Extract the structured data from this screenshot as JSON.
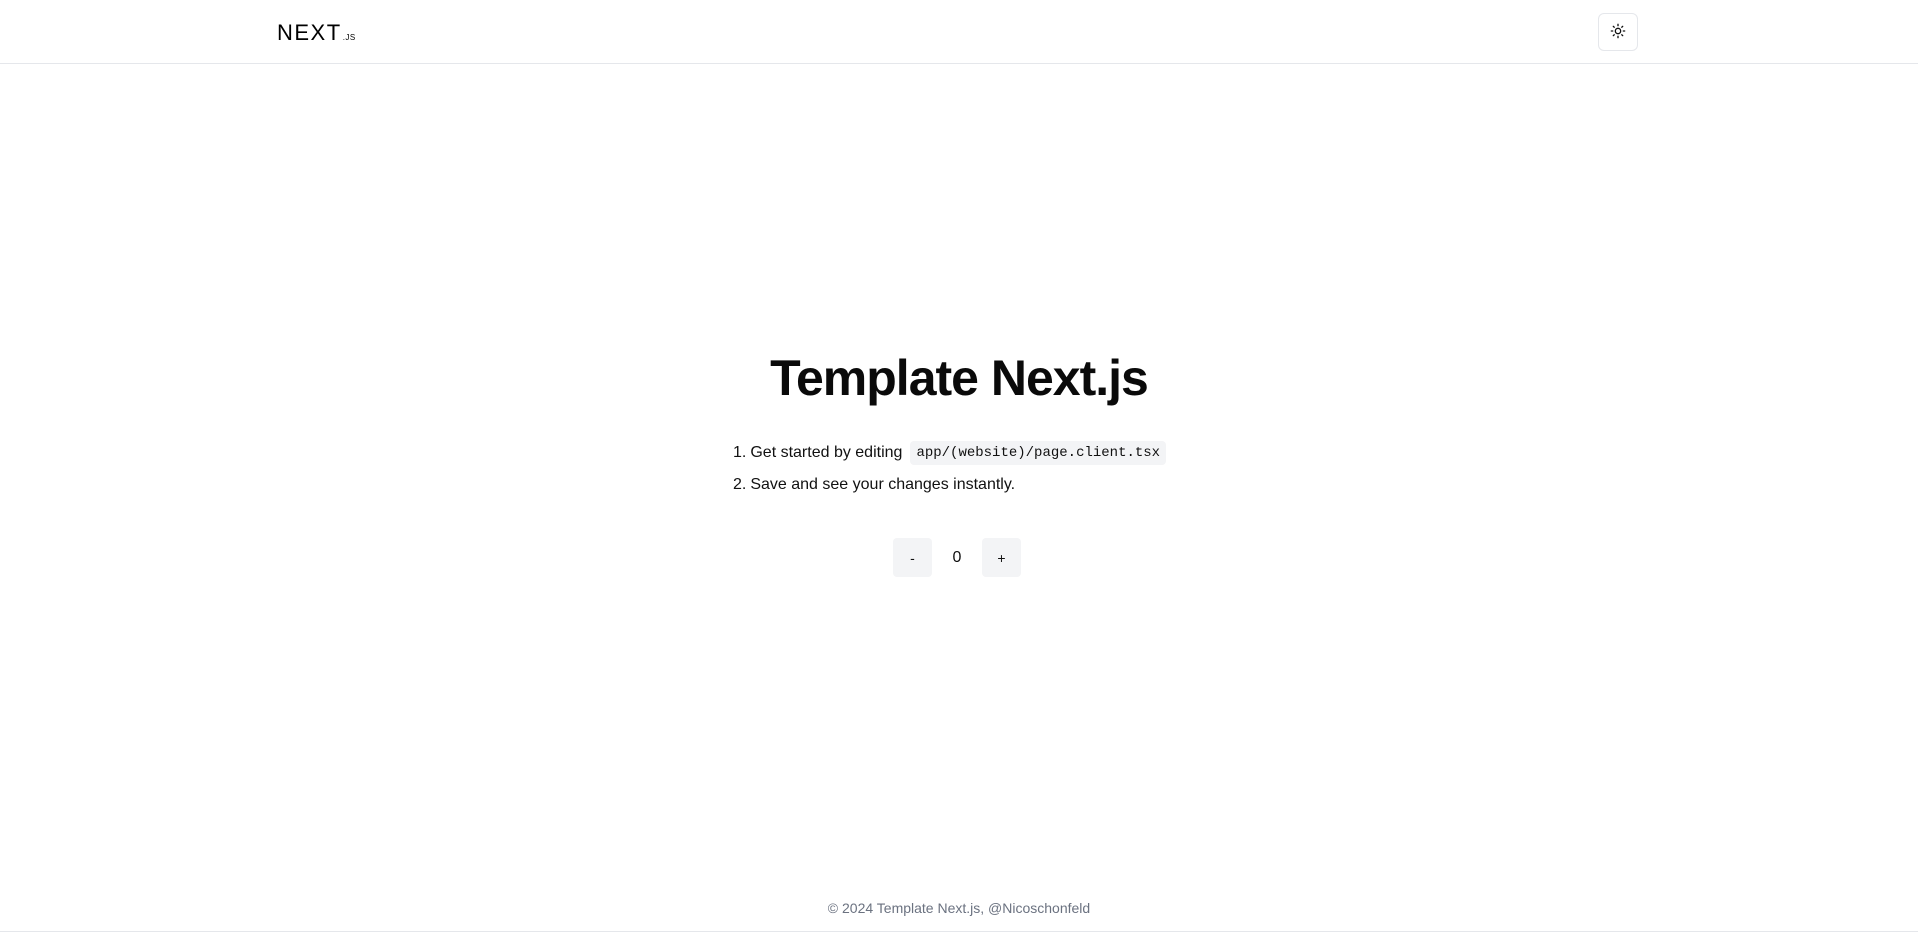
{
  "header": {
    "logo": {
      "main": "NEXT",
      "sub": ".JS",
      "icon": "nextjs-logo"
    },
    "theme_toggle": {
      "icon": "sun-icon"
    }
  },
  "main": {
    "title": "Template Next.js",
    "steps": [
      {
        "number": "1.",
        "text": "Get started by editing",
        "code": "app/(website)/page.client.tsx"
      },
      {
        "number": "2.",
        "text": "Save and see your changes instantly."
      }
    ],
    "counter": {
      "decrement_label": "-",
      "value": "0",
      "increment_label": "+"
    }
  },
  "footer": {
    "text": "© 2024 Template Next.js, @Nicoschonfeld"
  }
}
